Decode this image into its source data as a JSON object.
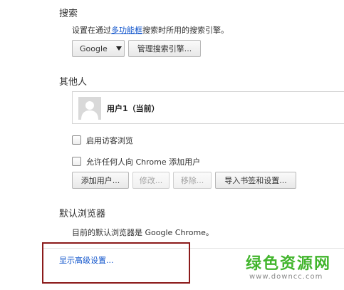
{
  "search": {
    "title": "搜索",
    "desc_prefix": "设置在通过",
    "desc_link": "多功能框",
    "desc_suffix": "搜索时所用的搜索引擎。",
    "engine_selected": "Google",
    "manage_button": "管理搜索引擎..."
  },
  "people": {
    "title": "其他人",
    "profile_name": "用户1（当前）",
    "guest_browsing_label": "启用访客浏览",
    "allow_add_label": "允许任何人向 Chrome 添加用户",
    "buttons": {
      "add_user": "添加用户...",
      "edit": "修改...",
      "remove": "移除...",
      "import": "导入书签和设置..."
    }
  },
  "default_browser": {
    "title": "默认浏览器",
    "desc": "目前的默认浏览器是 Google Chrome。"
  },
  "advanced": {
    "link_label": "显示高级设置..."
  },
  "watermark": {
    "text": "绿色资源网",
    "url": "www.downcc.com"
  },
  "colors": {
    "link": "#1155cc",
    "highlight_box": "#8b1a1a",
    "watermark_green": "#42b52d"
  }
}
